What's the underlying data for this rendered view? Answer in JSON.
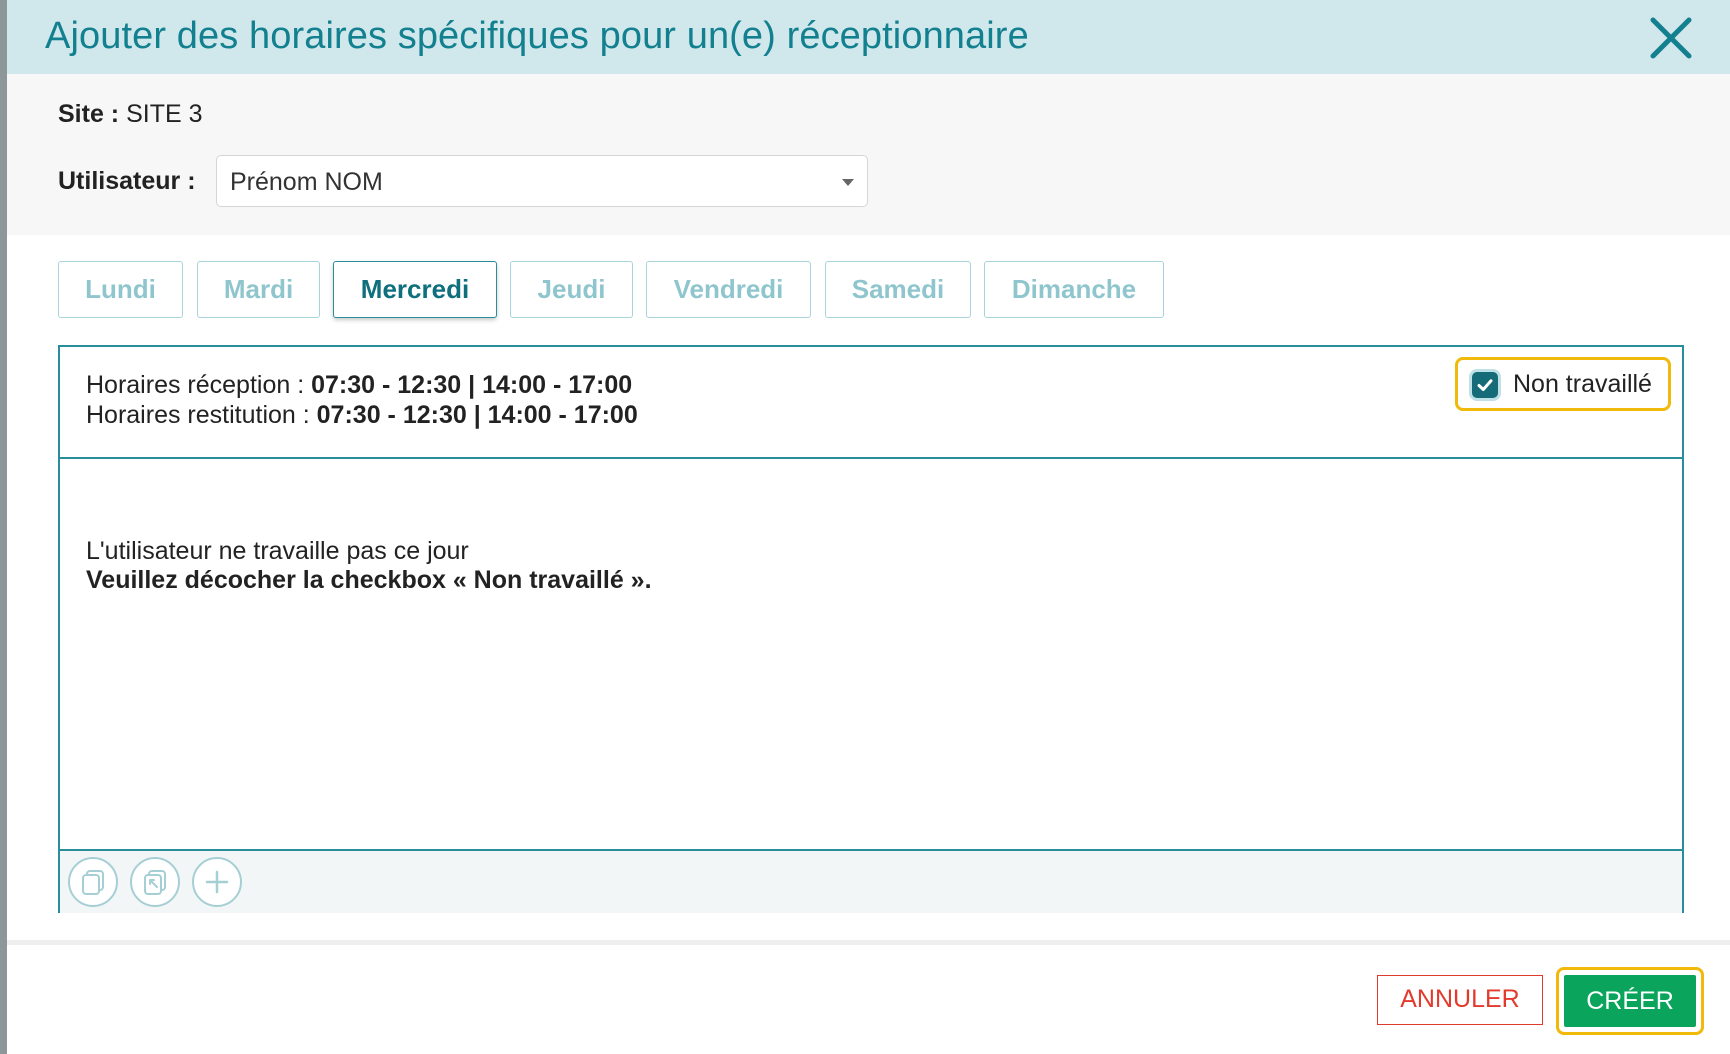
{
  "dialog": {
    "title": "Ajouter des horaires spécifiques pour un(e) réceptionnaire"
  },
  "site": {
    "label": "Site :",
    "value": "SITE 3"
  },
  "user": {
    "label": "Utilisateur :",
    "selected": "Prénom NOM"
  },
  "tabs": [
    {
      "label": "Lundi",
      "active": false
    },
    {
      "label": "Mardi",
      "active": false
    },
    {
      "label": "Mercredi",
      "active": true
    },
    {
      "label": "Jeudi",
      "active": false
    },
    {
      "label": "Vendredi",
      "active": false
    },
    {
      "label": "Samedi",
      "active": false
    },
    {
      "label": "Dimanche",
      "active": false
    }
  ],
  "panel": {
    "reception_label": "Horaires réception :",
    "reception_hours": "07:30 - 12:30 | 14:00 - 17:00",
    "restitution_label": "Horaires restitution :",
    "restitution_hours": "07:30 - 12:30 | 14:00 - 17:00",
    "non_worked_label": "Non travaillé",
    "non_worked_checked": true,
    "message_line1": "L'utilisateur ne travaille pas ce jour",
    "message_line2": "Veuillez décocher la checkbox « Non travaillé »."
  },
  "toolbar": {
    "icons": [
      "copy-icon",
      "paste-icon",
      "add-icon"
    ]
  },
  "footer": {
    "cancel_label": "ANNULER",
    "create_label": "CRÉER"
  },
  "colors": {
    "accent": "#12808f",
    "header_bg": "#d0e7ec",
    "create": "#0aa45c",
    "cancel": "#e23b2e",
    "highlight": "#f0b90b"
  }
}
